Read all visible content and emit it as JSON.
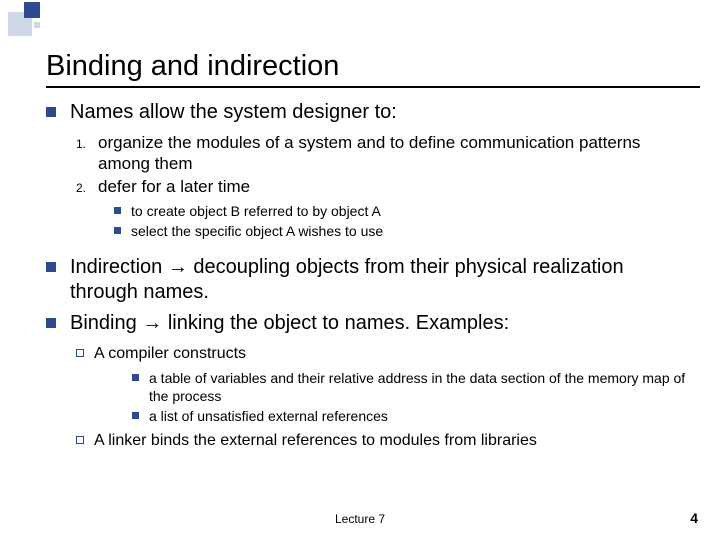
{
  "title": "Binding and indirection",
  "b1": "Names allow the system designer to:",
  "n1_label": "1.",
  "n1_text": "organize the modules of a system and to define communication patterns among them",
  "n2_label": "2.",
  "n2_text": "defer for a later time",
  "s1": "to create object B referred to by object A",
  "s2": "select the specific object A wishes to use",
  "b2": "Indirection → decoupling objects from their physical realization through names.",
  "b3": "Binding → linking the object to names. Examples:",
  "o1": "A compiler constructs",
  "o1s1": "a table of variables and their relative address in the data section of the memory map of the process",
  "o1s2": "a list of unsatisfied external references",
  "o2": "A linker binds the external references to modules from libraries",
  "footer": "Lecture 7",
  "page": "4"
}
